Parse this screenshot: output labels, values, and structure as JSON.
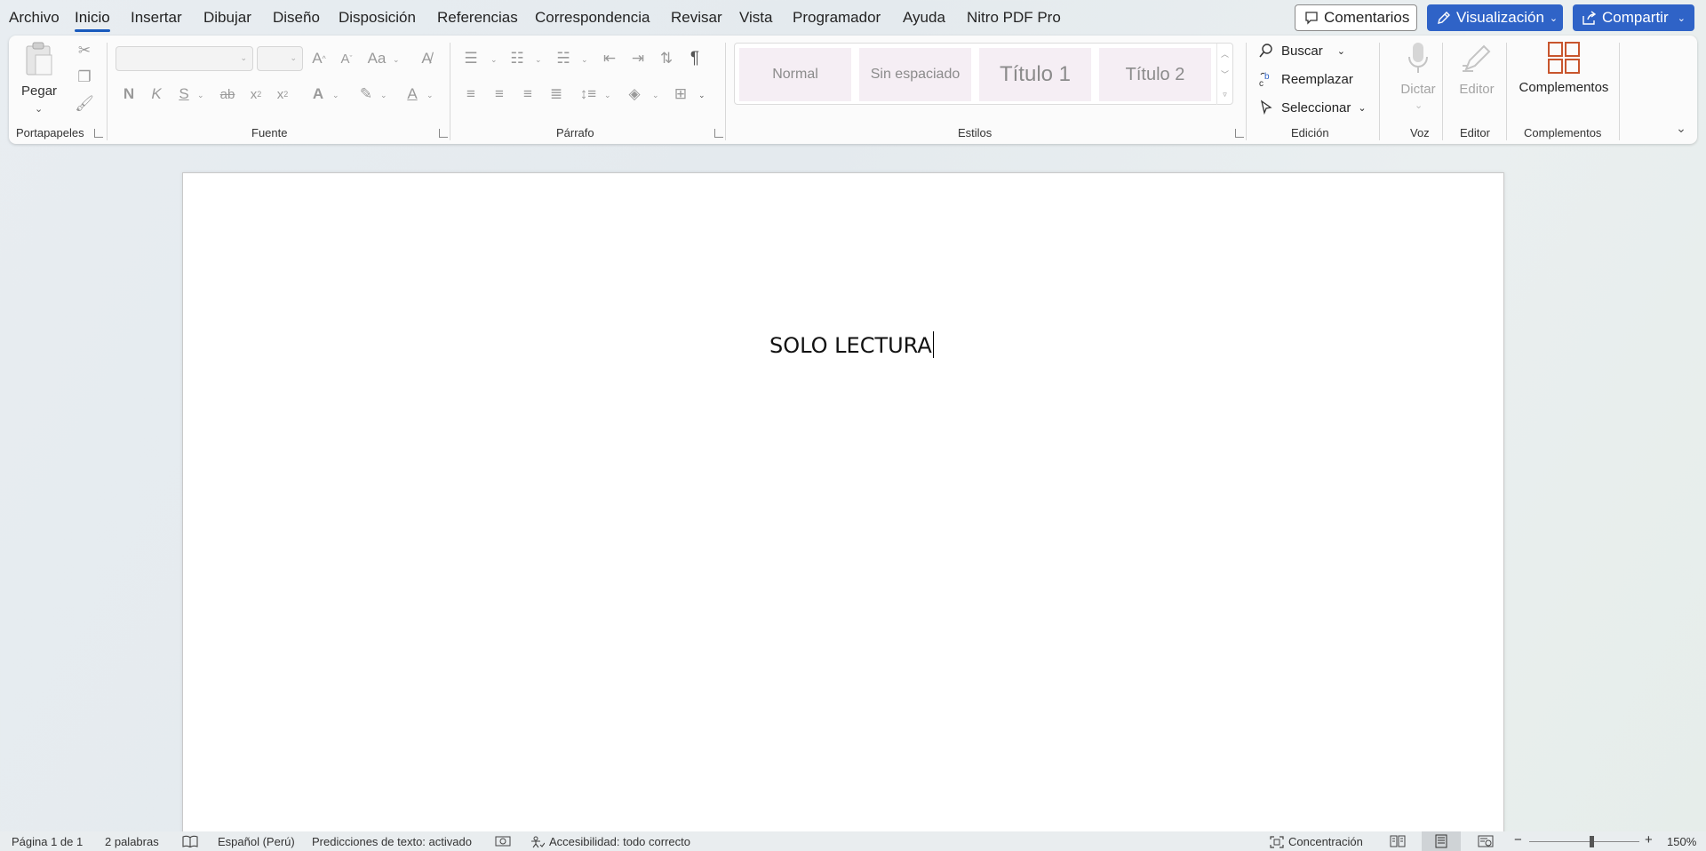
{
  "menu": {
    "tabs": [
      "Archivo",
      "Inicio",
      "Insertar",
      "Dibujar",
      "Diseño",
      "Disposición",
      "Referencias",
      "Correspondencia",
      "Revisar",
      "Vista",
      "Programador",
      "Ayuda",
      "Nitro PDF Pro"
    ],
    "active_tab": "Inicio",
    "comments_label": "Comentarios",
    "view_label": "Visualización",
    "share_label": "Compartir"
  },
  "ribbon": {
    "clipboard": {
      "paste_label": "Pegar",
      "group_label": "Portapapeles"
    },
    "font": {
      "group_label": "Fuente",
      "font_name": "",
      "font_size": "",
      "bold": "N",
      "italic": "K",
      "underline": "S",
      "strike": "ab",
      "case_label": "Aa"
    },
    "paragraph": {
      "group_label": "Párrafo",
      "pilcrow": "¶"
    },
    "styles": {
      "group_label": "Estilos",
      "items": [
        "Normal",
        "Sin espaciado",
        "Título 1",
        "Título 2"
      ]
    },
    "editing": {
      "group_label": "Edición",
      "find": "Buscar",
      "replace": "Reemplazar",
      "select": "Seleccionar"
    },
    "voice": {
      "group_label": "Voz",
      "dictate": "Dictar"
    },
    "editor": {
      "group_label": "Editor",
      "editor_label": "Editor"
    },
    "addins": {
      "group_label": "Complementos",
      "addins_label": "Complementos"
    }
  },
  "document": {
    "body_text": "SOLO LECTURA"
  },
  "status": {
    "page": "Página 1 de 1",
    "words": "2 palabras",
    "language": "Español (Perú)",
    "predictions": "Predicciones de texto: activado",
    "accessibility": "Accesibilidad: todo correcto",
    "focus": "Concentración",
    "zoom": "150%"
  },
  "colors": {
    "accent": "#2f63c7",
    "addins_icon": "#c8552d",
    "style_bg": "#f5eef4"
  }
}
